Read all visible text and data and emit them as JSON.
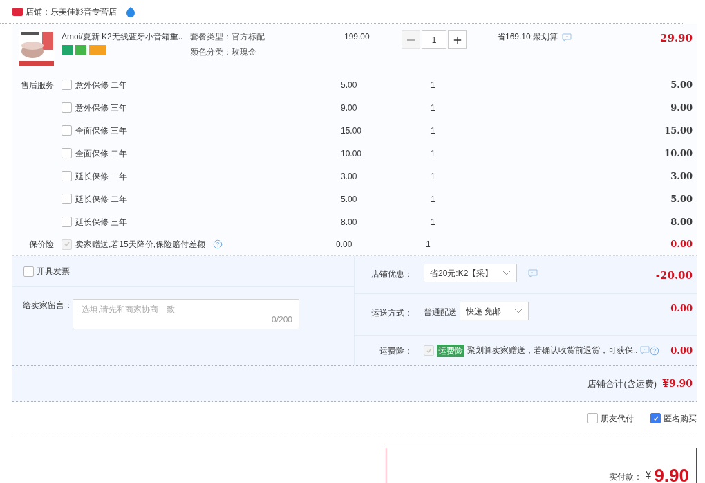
{
  "store": {
    "name": "店铺：乐美佳影音专营店"
  },
  "item": {
    "title": "Amoi/夏新 K2无线蓝牙小音箱重..",
    "specs": [
      "套餐类型：官方标配",
      "颜色分类：玫瑰金"
    ],
    "price": "199.00",
    "quantity": "1",
    "promo": "省169.10:聚划算",
    "total": "29.90"
  },
  "services": {
    "label": "售后服务",
    "rows": [
      {
        "name": "意外保修 二年",
        "price": "5.00",
        "quantity": "1",
        "total": "5.00",
        "checked": false
      },
      {
        "name": "意外保修 三年",
        "price": "9.00",
        "quantity": "1",
        "total": "9.00",
        "checked": false
      },
      {
        "name": "全面保修 三年",
        "price": "15.00",
        "quantity": "1",
        "total": "15.00",
        "checked": false
      },
      {
        "name": "全面保修 二年",
        "price": "10.00",
        "quantity": "1",
        "total": "10.00",
        "checked": false
      },
      {
        "name": "延长保修 一年",
        "price": "3.00",
        "quantity": "1",
        "total": "3.00",
        "checked": false
      },
      {
        "name": "延长保修 二年",
        "price": "5.00",
        "quantity": "1",
        "total": "5.00",
        "checked": false
      },
      {
        "name": "延长保修 三年",
        "price": "8.00",
        "quantity": "1",
        "total": "8.00",
        "checked": false
      }
    ]
  },
  "price_protection": {
    "label": "保价险",
    "checked": true,
    "disabled": true,
    "text": "卖家赠送,若15天降价,保险赔付差额",
    "price": "0.00",
    "quantity": "1",
    "total": "0.00"
  },
  "invoice": {
    "label": "开具发票",
    "checked": false
  },
  "message": {
    "label": "给卖家留言：",
    "placeholder": "选填,请先和商家协商一致",
    "counter": "0/200"
  },
  "shop_discount": {
    "label": "店铺优惠：",
    "value": "省20元:K2【采】",
    "amount": "-20.00"
  },
  "shipping": {
    "label": "运送方式：",
    "method": "普通配送",
    "value": "快递 免邮",
    "amount": "0.00"
  },
  "freight_insurance": {
    "label": "运费险：",
    "checked": true,
    "disabled": true,
    "tag": "运费险",
    "text": "聚划算卖家赠送，若确认收货前退货，可获保..",
    "amount": "0.00"
  },
  "subtotal": {
    "label": "店铺合计(含运费)",
    "amount": "¥9.90"
  },
  "options": [
    {
      "label": "朋友代付",
      "checked": false
    },
    {
      "label": "匿名购买",
      "checked": true
    }
  ],
  "pay": {
    "label": "实付款：",
    "currency": "¥",
    "amount": "9.90"
  }
}
